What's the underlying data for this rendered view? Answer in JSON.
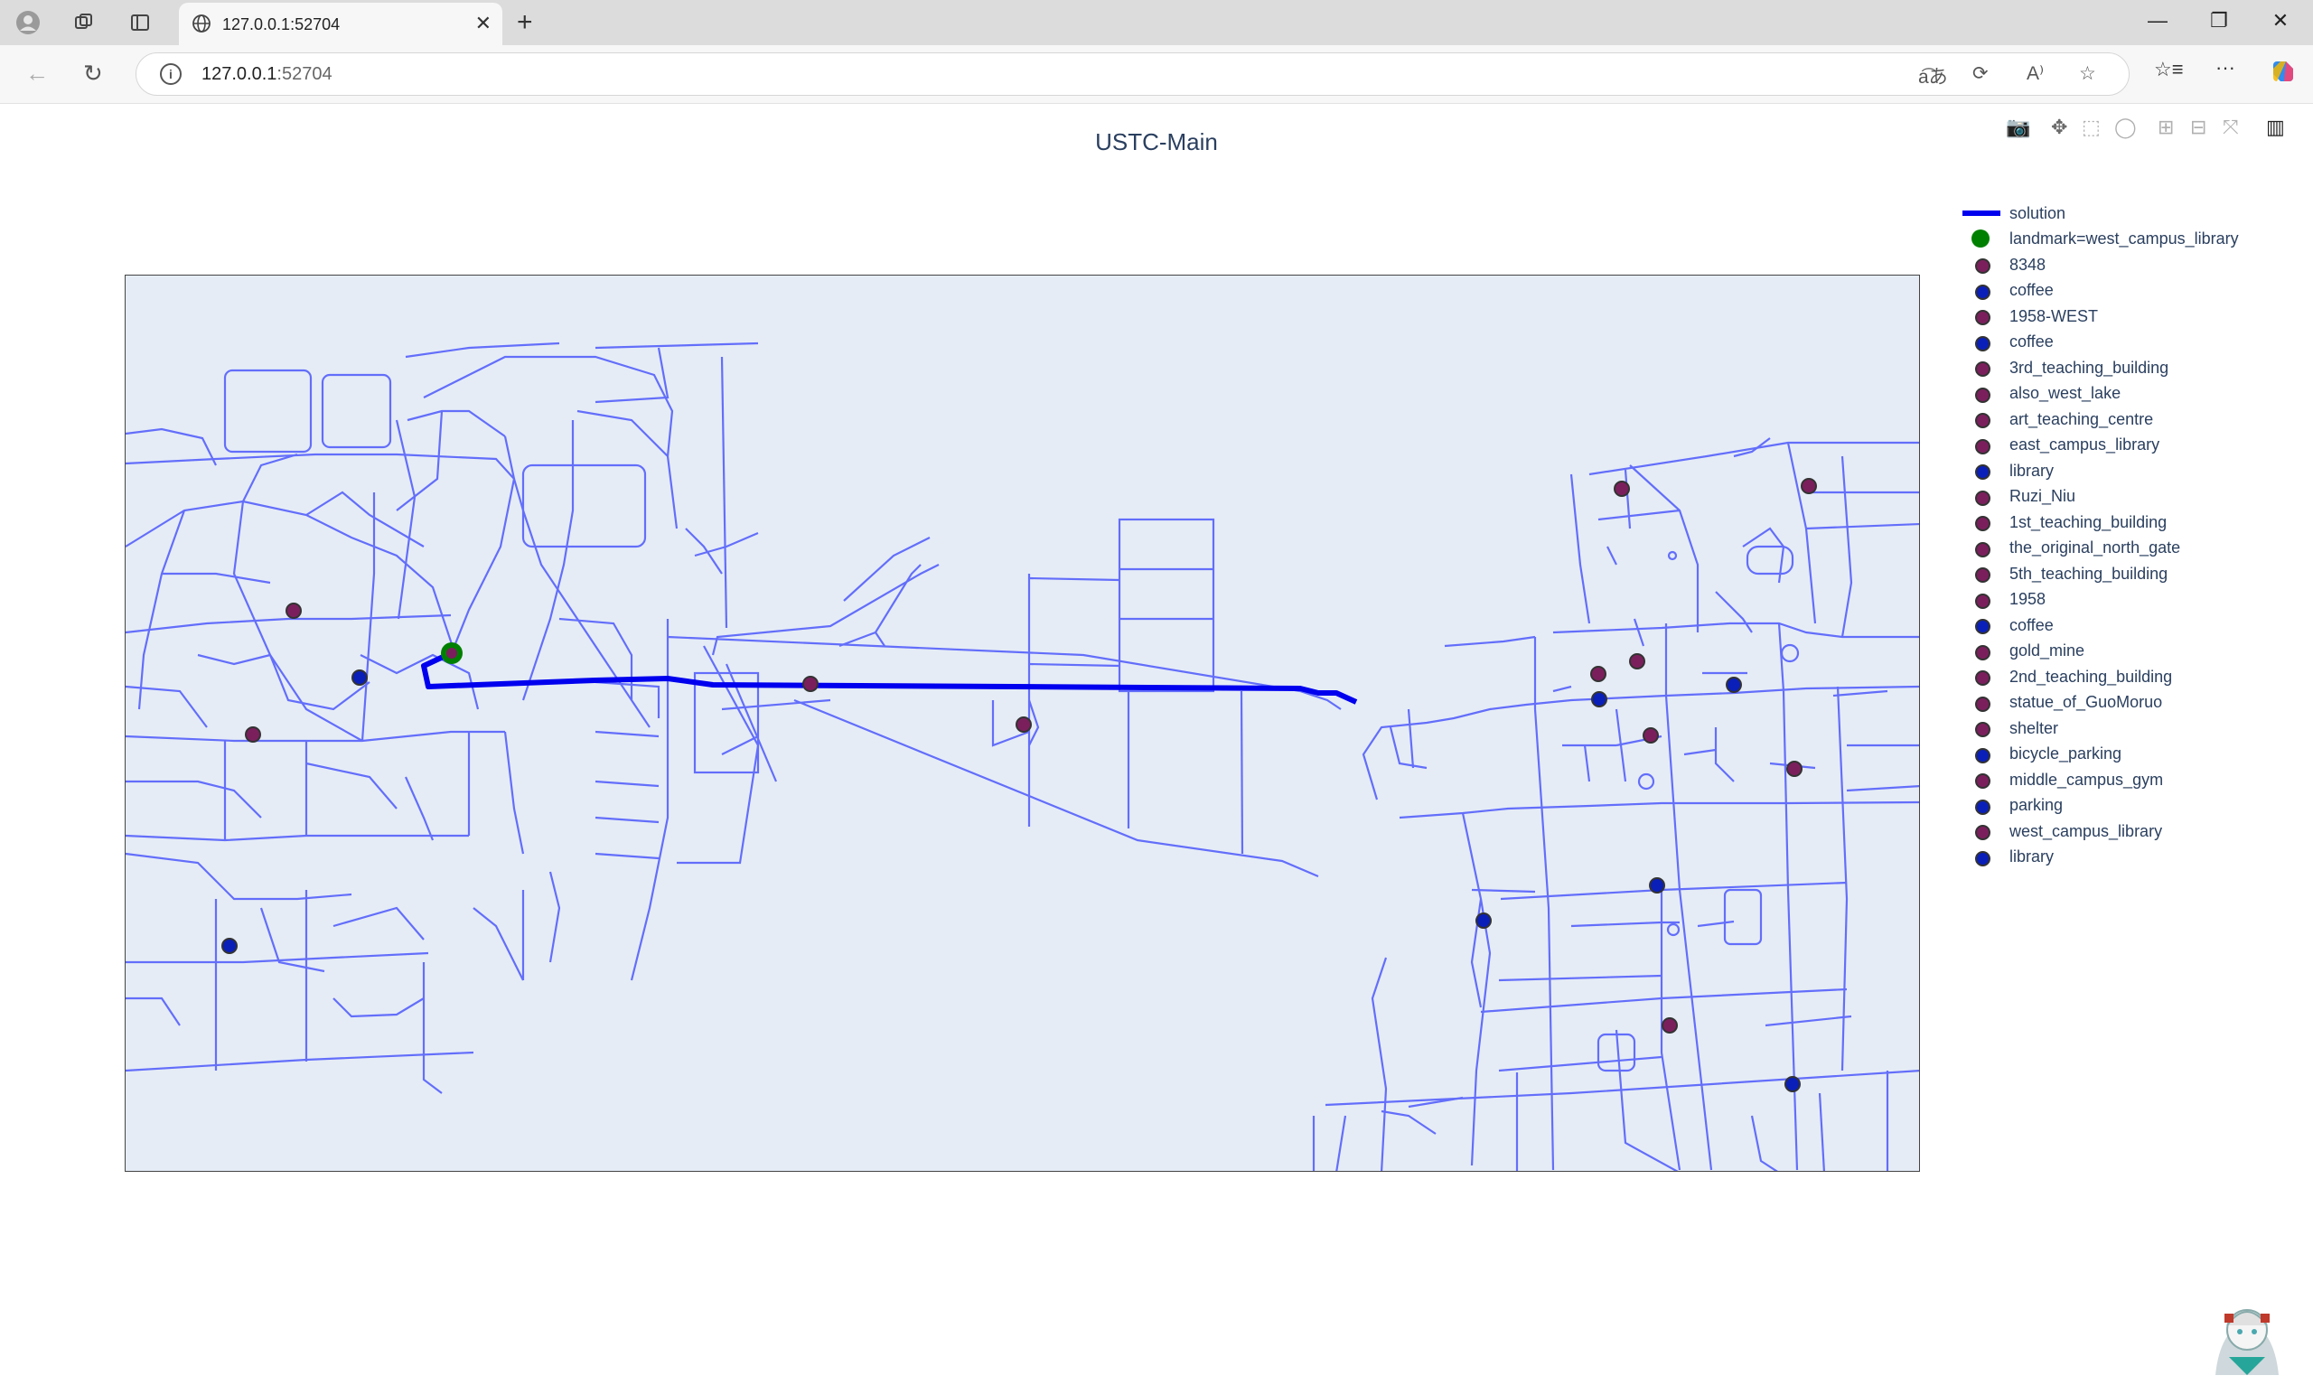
{
  "browser": {
    "tab_title": "127.0.0.1:52704",
    "url_host": "127.0.0.1",
    "url_port": ":52704"
  },
  "plot": {
    "title": "USTC-Main",
    "route_color": "#0000ee",
    "road_color": "#636efa",
    "bg_color": "#e5ecf6"
  },
  "legend": [
    {
      "label": "solution",
      "kind": "line",
      "color": "#0000ee"
    },
    {
      "label": "landmark=west_campus_library",
      "kind": "dot",
      "color": "#008000"
    },
    {
      "label": "8348",
      "kind": "dot",
      "color": "#7b1f5c"
    },
    {
      "label": "coffee",
      "kind": "dot",
      "color": "#0a1fb8"
    },
    {
      "label": "1958-WEST",
      "kind": "dot",
      "color": "#7b1f5c"
    },
    {
      "label": "coffee",
      "kind": "dot",
      "color": "#0a1fb8"
    },
    {
      "label": "3rd_teaching_building",
      "kind": "dot",
      "color": "#7b1f5c"
    },
    {
      "label": "also_west_lake",
      "kind": "dot",
      "color": "#7b1f5c"
    },
    {
      "label": "art_teaching_centre",
      "kind": "dot",
      "color": "#7b1f5c"
    },
    {
      "label": "east_campus_library",
      "kind": "dot",
      "color": "#7b1f5c"
    },
    {
      "label": "library",
      "kind": "dot",
      "color": "#0a1fb8"
    },
    {
      "label": "Ruzi_Niu",
      "kind": "dot",
      "color": "#7b1f5c"
    },
    {
      "label": "1st_teaching_building",
      "kind": "dot",
      "color": "#7b1f5c"
    },
    {
      "label": "the_original_north_gate",
      "kind": "dot",
      "color": "#7b1f5c"
    },
    {
      "label": "5th_teaching_building",
      "kind": "dot",
      "color": "#7b1f5c"
    },
    {
      "label": "1958",
      "kind": "dot",
      "color": "#7b1f5c"
    },
    {
      "label": "coffee",
      "kind": "dot",
      "color": "#0a1fb8"
    },
    {
      "label": "gold_mine",
      "kind": "dot",
      "color": "#7b1f5c"
    },
    {
      "label": "2nd_teaching_building",
      "kind": "dot",
      "color": "#7b1f5c"
    },
    {
      "label": "statue_of_GuoMoruo",
      "kind": "dot",
      "color": "#7b1f5c"
    },
    {
      "label": "shelter",
      "kind": "dot",
      "color": "#7b1f5c"
    },
    {
      "label": "bicycle_parking",
      "kind": "dot",
      "color": "#0a1fb8"
    },
    {
      "label": "middle_campus_gym",
      "kind": "dot",
      "color": "#7b1f5c"
    },
    {
      "label": "parking",
      "kind": "dot",
      "color": "#0a1fb8"
    },
    {
      "label": "west_campus_library",
      "kind": "dot",
      "color": "#7b1f5c"
    },
    {
      "label": "library",
      "kind": "dot",
      "color": "#0a1fb8"
    }
  ]
}
